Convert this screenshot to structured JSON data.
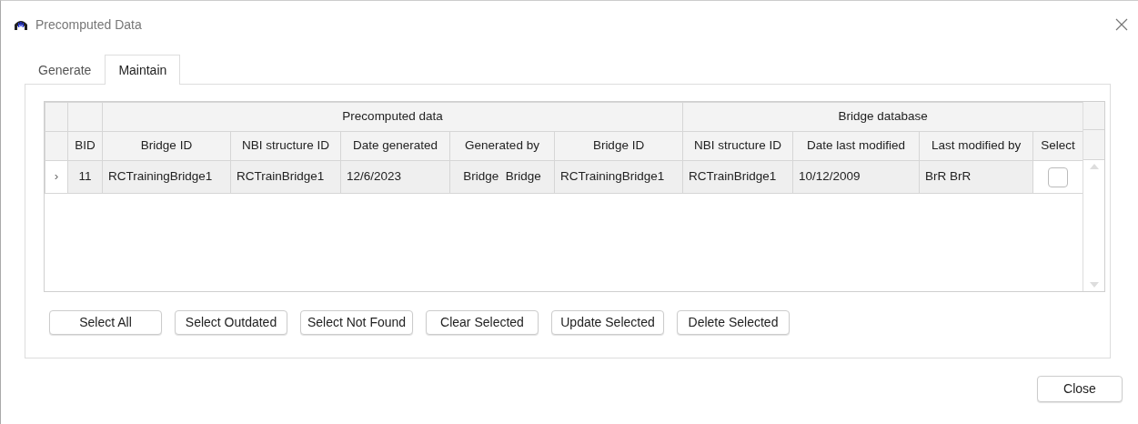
{
  "window": {
    "title": "Precomputed Data"
  },
  "tabs": [
    {
      "label": "Generate",
      "selected": false
    },
    {
      "label": "Maintain",
      "selected": true
    }
  ],
  "table": {
    "groups": [
      "Precomputed data",
      "Bridge database"
    ],
    "columns": [
      "BID",
      "Bridge ID",
      "NBI structure ID",
      "Date generated",
      "Generated by",
      "Bridge ID",
      "NBI structure ID",
      "Date last modified",
      "Last modified by",
      "Select"
    ],
    "rows": [
      {
        "indicator": "›",
        "cells": [
          "11",
          "RCTrainingBridge1",
          "RCTrainBridge1",
          "12/6/2023",
          "Bridge  Bridge",
          "RCTrainingBridge1",
          "RCTrainBridge1",
          "10/12/2009",
          "BrR BrR"
        ],
        "checked": false
      }
    ]
  },
  "buttons": [
    "Select All",
    "Select Outdated",
    "Select Not Found",
    "Clear Selected",
    "Update Selected",
    "Delete Selected"
  ],
  "footer_button": "Close"
}
